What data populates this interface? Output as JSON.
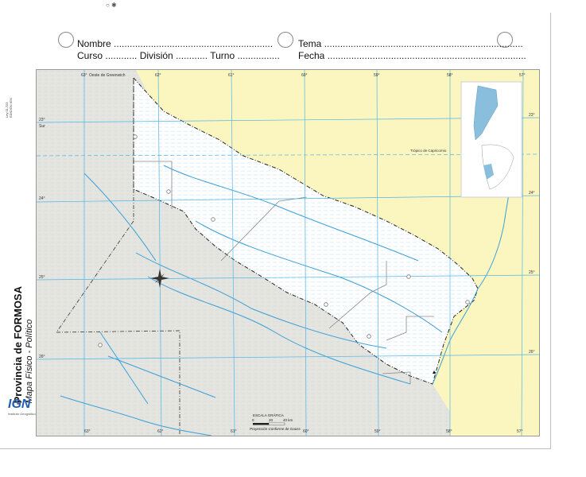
{
  "header": {
    "top_mark": "○ ✱",
    "nombre_label": "Nombre",
    "nombre_dots": "............................................................",
    "curso_label": "Curso",
    "curso_dots": "............",
    "division_label": "División",
    "division_dots": "............",
    "turno_label": "Turno",
    "turno_dots": "................",
    "tema_label": "Tema",
    "tema_dots": "...........................................................................",
    "fecha_label": "Fecha",
    "fecha_dots": "..........................................................................."
  },
  "side": {
    "legal_line1": "Ley 11.723",
    "legal_line2": "EDICIÓN IGN",
    "title": "Provincia de FORMOSA",
    "subtitle": "Mapa Físico - Político",
    "logo_text": "IGN",
    "logo_caption": "Instituto Geográfico Nacional"
  },
  "map": {
    "top_lon_labels": [
      "63°",
      "62°",
      "61°",
      "60°",
      "59°",
      "58°",
      "57°"
    ],
    "bottom_lon_labels": [
      "63°",
      "62°",
      "61°",
      "60°",
      "59°",
      "58°",
      "57°"
    ],
    "left_lat_labels": [
      "23°",
      "24°",
      "25°",
      "26°"
    ],
    "right_lat_labels": [
      "23°",
      "24°",
      "25°",
      "26°"
    ],
    "greenwich_label": "Oeste de Greenwich",
    "sur_label": "Sur",
    "tropic_label": "Trópico de Capricornio",
    "scale_title": "ESCALA GRÁFICA",
    "scale_ticks": [
      "0",
      "20",
      "40 km"
    ],
    "projection": "Proyección Conforme de Gauss",
    "colors": {
      "province": "#ffffff",
      "neighbor_argentina": "#e6e4de",
      "paraguay": "#fbf6c0",
      "grid": "#4fb6e8",
      "river": "#3a9fd8"
    }
  }
}
